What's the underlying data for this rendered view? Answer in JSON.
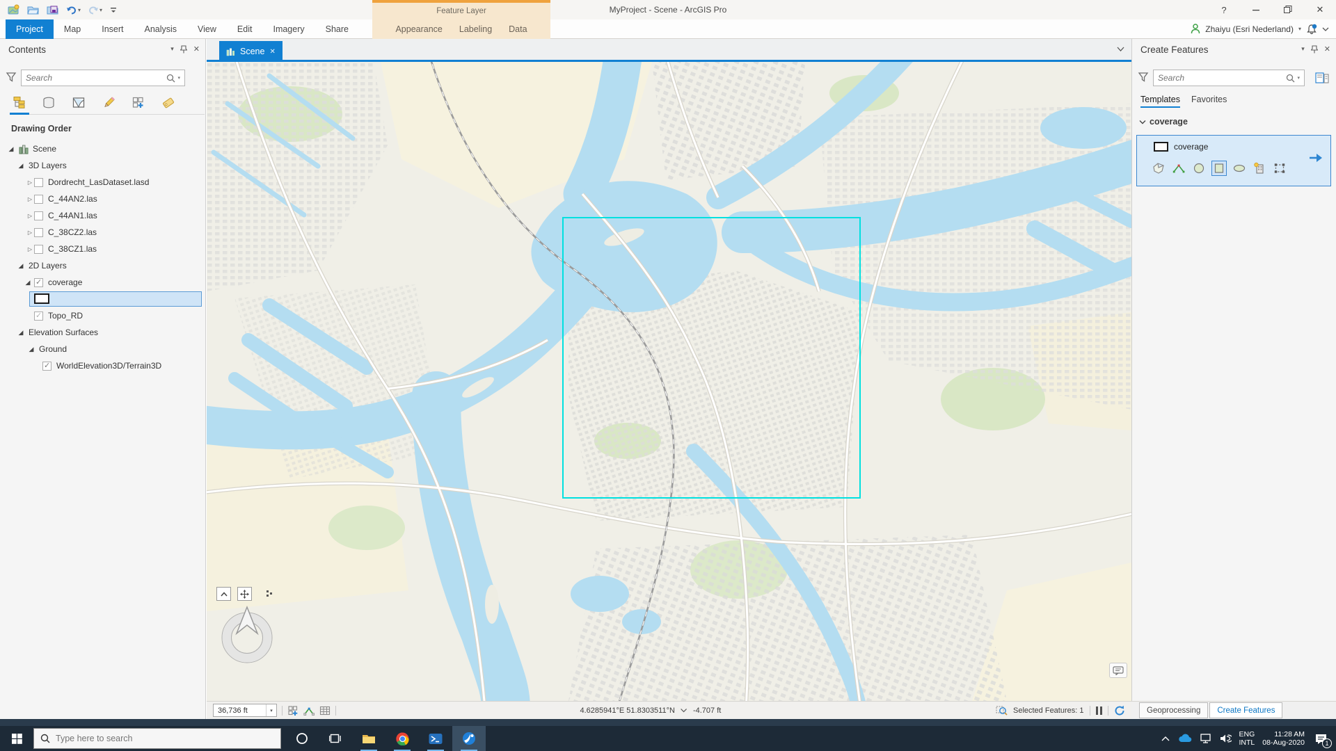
{
  "app": {
    "title": "MyProject - Scene - ArcGIS Pro"
  },
  "titlebar": {
    "contextual_header": "Feature Layer",
    "help_label": "?",
    "qat_icons": [
      "new-project",
      "open-project",
      "save-project",
      "undo",
      "redo",
      "customize-quick-access"
    ]
  },
  "ribbon": {
    "tabs": [
      "Project",
      "Map",
      "Insert",
      "Analysis",
      "View",
      "Edit",
      "Imagery",
      "Share"
    ],
    "active_tab": "Project",
    "contextual_tabs": [
      "Appearance",
      "Labeling",
      "Data"
    ],
    "user_name": "Zhaiyu (Esri Nederland)"
  },
  "contents_panel": {
    "title": "Contents",
    "search_placeholder": "Search",
    "toolbar_icons": [
      "list-by-drawing-order",
      "list-by-data-source",
      "list-by-selection",
      "list-by-editing",
      "list-by-snapping",
      "list-by-labeling"
    ],
    "section_label": "Drawing Order",
    "tree": [
      {
        "label": "Scene",
        "expanded": true
      },
      {
        "label": "3D Layers",
        "expanded": true
      },
      {
        "label": "Dordrecht_LasDataset.lasd",
        "expanded": false,
        "checked": false
      },
      {
        "label": "C_44AN2.las",
        "expanded": false,
        "checked": false
      },
      {
        "label": "C_44AN1.las",
        "expanded": false,
        "checked": false
      },
      {
        "label": "C_38CZ2.las",
        "expanded": false,
        "checked": false
      },
      {
        "label": "C_38CZ1.las",
        "expanded": false,
        "checked": false
      },
      {
        "label": "2D Layers",
        "expanded": true
      },
      {
        "label": "coverage",
        "expanded": true,
        "checked": true
      },
      {
        "label": "",
        "symbol": "coverage-rectangle-symbol",
        "selected": true
      },
      {
        "label": "Topo_RD",
        "checked": true
      },
      {
        "label": "Elevation Surfaces",
        "expanded": true
      },
      {
        "label": "Ground",
        "expanded": true
      },
      {
        "label": "WorldElevation3D/Terrain3D",
        "checked": true
      }
    ]
  },
  "map_view": {
    "tab_label": "Scene",
    "selection_color": "#00e0e0",
    "statusbar": {
      "scale": "36,736 ft",
      "coordinates": "4.6285941°E 51.8303511°N",
      "elevation": "-4.707 ft",
      "selected_features": "Selected Features: 1"
    }
  },
  "create_features_panel": {
    "title": "Create Features",
    "search_placeholder": "Search",
    "tabs": [
      "Templates",
      "Favorites"
    ],
    "active_tab": "Templates",
    "group_label": "coverage",
    "template_name": "coverage",
    "tool_icons": [
      "polygon-tool",
      "line-tool",
      "circle-tool",
      "rectangle-tool",
      "ellipse-tool",
      "autocomplete-polygon-tool",
      "freehand-extent-tool"
    ],
    "active_tool": "rectangle-tool"
  },
  "dock_tabs": {
    "items": [
      "Geoprocessing",
      "Create Features"
    ],
    "active": "Create Features"
  },
  "taskbar": {
    "search_placeholder": "Type here to search",
    "app_icons": [
      "start",
      "cortana",
      "task-view",
      "file-explorer",
      "chrome",
      "powershell",
      "arcgis-pro"
    ],
    "tray_icons": [
      "hidden-icons-chevron",
      "onedrive",
      "network",
      "volume",
      "action-center"
    ],
    "language_line1": "ENG",
    "language_line2": "INTL",
    "time": "11:28 AM",
    "date": "08-Aug-2020",
    "notification_badge": "1"
  },
  "colors": {
    "accent_blue": "#1180d2",
    "contextual_orange": "#efa23d",
    "selection_cyan": "#00e0e0",
    "taskbar_dark": "#1d2a37"
  }
}
